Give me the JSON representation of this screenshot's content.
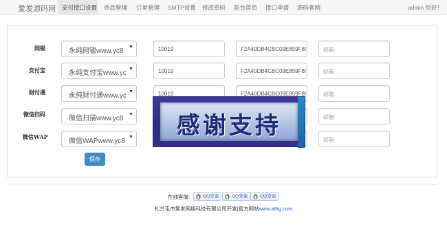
{
  "navbar": {
    "brand": "爱发源码网",
    "items": [
      {
        "label": "支付接口设置",
        "active": true
      },
      {
        "label": "商品管理",
        "active": false
      },
      {
        "label": "订单管理",
        "active": false
      },
      {
        "label": "SMTP设置",
        "active": false
      },
      {
        "label": "修改密码",
        "active": false
      },
      {
        "label": "前台首页",
        "active": false
      },
      {
        "label": "接口申请",
        "active": false
      },
      {
        "label": "源码客网",
        "active": false
      }
    ],
    "user": "admin 你好！"
  },
  "payment_rows": [
    {
      "label": "网银",
      "channel": "永纯网银www.yc8",
      "merchant_id": "10019",
      "key": "F2A40DB4CBC09E859F8/",
      "email_placeholder": "邮箱"
    },
    {
      "label": "支付宝",
      "channel": "永纯支付宝www.yc",
      "merchant_id": "10019",
      "key": "F2A40DB4CBC09E859F8/",
      "email_placeholder": "邮箱"
    },
    {
      "label": "财付通",
      "channel": "永纯财付通www.yc",
      "merchant_id": "10019",
      "key": "F2A40DB4CBC09E859F8/",
      "email_placeholder": "邮箱"
    },
    {
      "label": "微信扫码",
      "channel": "微信扫描www.yc8",
      "merchant_id": "",
      "key": "",
      "email_placeholder": "邮箱"
    },
    {
      "label": "微信WAP",
      "channel": "微信WAPwww.yc8",
      "merchant_id": "",
      "key": "",
      "email_placeholder": "邮箱"
    }
  ],
  "save_label": "保存",
  "overlay": {
    "text": "感谢支持"
  },
  "footer": {
    "service_label": "在线客服:",
    "qq_buttons": [
      "QQ交谈",
      "QQ交谈",
      "QQ交谈"
    ],
    "copyright": "扎兰屯市爱发网络科技有限公司开发|官方网站",
    "site_link": "www.a8tg.com"
  },
  "colors": {
    "primary": "#428bca",
    "link": "#1a64c4",
    "overlay": "#2f2b86"
  }
}
